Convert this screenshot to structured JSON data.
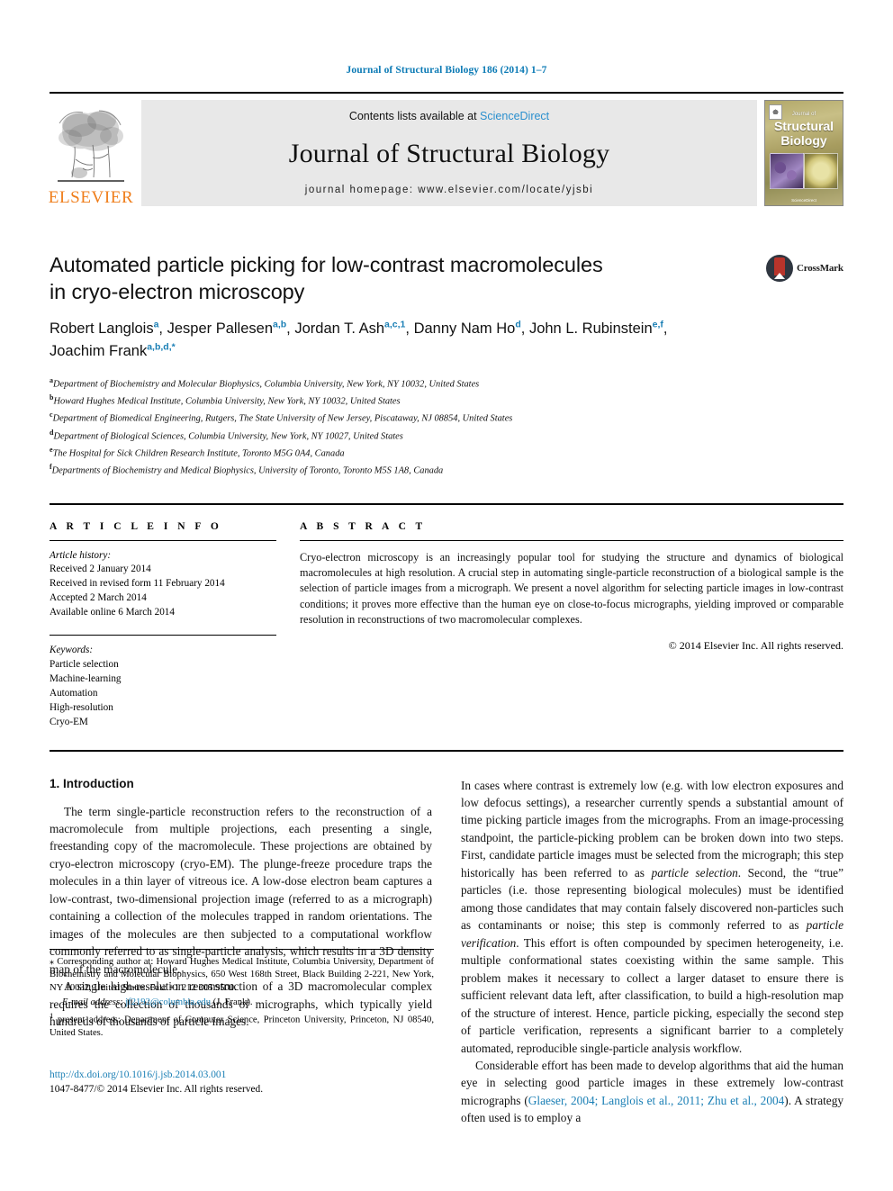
{
  "running_head": "Journal of Structural Biology 186 (2014) 1–7",
  "masthead": {
    "contents_prefix": "Contents lists available at ",
    "sciencedirect": "ScienceDirect",
    "journal_title": "Journal of Structural Biology",
    "homepage": "journal homepage: www.elsevier.com/locate/yjsbi",
    "publisher_word": "ELSEVIER",
    "cover": {
      "small_label": "Journal of",
      "line1": "Structural",
      "line2": "Biology",
      "bottom": "ScienceDirect"
    }
  },
  "article": {
    "title_line1": "Automated particle picking for low-contrast macromolecules",
    "title_line2": "in cryo-electron microscopy",
    "crossmark_label": "CrossMark",
    "authors": [
      {
        "name": "Robert Langlois",
        "sup": "a",
        "sep": ", "
      },
      {
        "name": "Jesper Pallesen",
        "sup": "a,b",
        "sep": ", "
      },
      {
        "name": "Jordan T. Ash",
        "sup": "a,c,1",
        "sep": ", "
      },
      {
        "name": "Danny Nam Ho",
        "sup": "d",
        "sep": ", "
      },
      {
        "name": "John L. Rubinstein",
        "sup": "e,f",
        "sep": ", "
      },
      {
        "name": "Joachim Frank",
        "sup": "a,b,d,*",
        "sep": ""
      }
    ],
    "affiliations": [
      {
        "mark": "a",
        "text": "Department of Biochemistry and Molecular Biophysics, Columbia University, New York, NY 10032, United States"
      },
      {
        "mark": "b",
        "text": "Howard Hughes Medical Institute, Columbia University, New York, NY 10032, United States"
      },
      {
        "mark": "c",
        "text": "Department of Biomedical Engineering, Rutgers, The State University of New Jersey, Piscataway, NJ 08854, United States"
      },
      {
        "mark": "d",
        "text": "Department of Biological Sciences, Columbia University, New York, NY 10027, United States"
      },
      {
        "mark": "e",
        "text": "The Hospital for Sick Children Research Institute, Toronto M5G 0A4, Canada"
      },
      {
        "mark": "f",
        "text": "Departments of Biochemistry and Medical Biophysics, University of Toronto, Toronto M5S 1A8, Canada"
      }
    ]
  },
  "info": {
    "heading": "A R T I C L E    I N F O",
    "history_label": "Article history:",
    "history": [
      "Received 2 January 2014",
      "Received in revised form 11 February 2014",
      "Accepted 2 March 2014",
      "Available online 6 March 2014"
    ],
    "keywords_label": "Keywords:",
    "keywords": [
      "Particle selection",
      "Machine-learning",
      "Automation",
      "High-resolution",
      "Cryo-EM"
    ]
  },
  "abstract": {
    "heading": "A B S T R A C T",
    "text": "Cryo-electron microscopy is an increasingly popular tool for studying the structure and dynamics of biological macromolecules at high resolution. A crucial step in automating single-particle reconstruction of a biological sample is the selection of particle images from a micrograph. We present a novel algorithm for selecting particle images in low-contrast conditions; it proves more effective than the human eye on close-to-focus micrographs, yielding improved or comparable resolution in reconstructions of two macromolecular complexes.",
    "copyright": "© 2014 Elsevier Inc. All rights reserved."
  },
  "body": {
    "section_heading": "1. Introduction",
    "left_paragraphs": [
      "The term single-particle reconstruction refers to the reconstruction of a macromolecule from multiple projections, each presenting a single, freestanding copy of the macromolecule. These projections are obtained by cryo-electron microscopy (cryo-EM). The plunge-freeze procedure traps the molecules in a thin layer of vitreous ice. A low-dose electron beam captures a low-contrast, two-dimensional projection image (referred to as a micrograph) containing a collection of the molecules trapped in random orientations. The images of the molecules are then subjected to a computational workflow commonly referred to as single-particle analysis, which results in a 3D density map of the macromolecule.",
      "A single high-resolution reconstruction of a 3D macromolecular complex requires the collection of thousands of micrographs, which typically yield hundreds of thousands of particle images."
    ],
    "right_paragraph_1_a": "In cases where contrast is extremely low (e.g. with low electron exposures and low defocus settings), a researcher currently spends a substantial amount of time picking particle images from the micrographs. From an image-processing standpoint, the particle-picking problem can be broken down into two steps. First, candidate particle images must be selected from the micrograph; this step historically has been referred to as ",
    "right_term_1": "particle selection",
    "right_paragraph_1_b": ". Second, the “true” particles (i.e. those representing biological molecules) must be identified among those candidates that may contain falsely discovered non-particles such as contaminants or noise; this step is commonly referred to as ",
    "right_term_2": "particle verification",
    "right_paragraph_1_c": ". This effort is often compounded by specimen heterogeneity, i.e. multiple conformational states coexisting within the same sample. This problem makes it necessary to collect a larger dataset to ensure there is sufficient relevant data left, after classification, to build a high-resolution map of the structure of interest. Hence, particle picking, especially the second step of particle verification, represents a significant barrier to a completely automated, reproducible single-particle analysis workflow.",
    "right_paragraph_2_a": "Considerable effort has been made to develop algorithms that aid the human eye in selecting good particle images in these extremely low-contrast micrographs (",
    "right_citation": "Glaeser, 2004; Langlois et al., 2011; Zhu et al., 2004",
    "right_paragraph_2_b": "). A strategy often used is to employ a"
  },
  "footnotes": {
    "corresponding_symbol": "⁎",
    "corresponding": " Corresponding author at: Howard Hughes Medical Institute, Columbia University, Department of Biochemistry and Molecular Biophysics, 650 West 168th Street, Black Building 2-221, New York, NY 10032, United States. Fax: +1 212 305 9500.",
    "email_label": "E-mail address:",
    "email": "jf2192@columbia.edu",
    "email_owner": " (J. Frank).",
    "present_symbol": "1",
    "present_address": " present address: Department of Computer Science, Princeton University, Princeton, NJ 08540, United States."
  },
  "imprint": {
    "doi": "http://dx.doi.org/10.1016/j.jsb.2014.03.001",
    "issn_line": "1047-8477/© 2014 Elsevier Inc. All rights reserved."
  },
  "colors": {
    "link_blue": "#1a7fb5",
    "elsevier_orange": "#ef7d1a",
    "masthead_gray": "#e8e8e8"
  }
}
